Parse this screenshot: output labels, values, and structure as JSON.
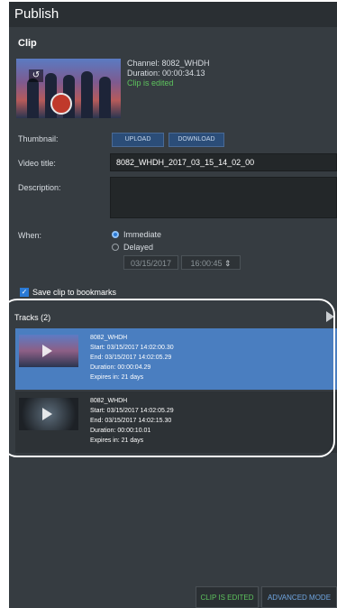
{
  "header": {
    "title": "Publish"
  },
  "clip": {
    "section_title": "Clip",
    "channel": "Channel: 8082_WHDH",
    "duration": "Duration: 00:00:34.13",
    "status": "Clip is edited"
  },
  "form": {
    "thumbnail_label": "Thumbnail:",
    "upload_label": "UPLOAD",
    "download_label": "DOWNLOAD",
    "video_title_label": "Video title:",
    "video_title_value": "8082_WHDH_2017_03_15_14_02_00",
    "description_label": "Description:",
    "description_value": "",
    "when_label": "When:",
    "immediate_label": "Immediate",
    "delayed_label": "Delayed",
    "date_value": "03/15/2017",
    "time_value": "16:00:45",
    "bookmark_label": "Save clip to bookmarks",
    "bookmark_checked": true
  },
  "tracks": {
    "header": "Tracks (2)",
    "items": [
      {
        "name": "8082_WHDH",
        "start": "Start: 03/15/2017 14:02:00.30",
        "end": "End: 03/15/2017 14:02:05.29",
        "duration": "Duration: 00:00:04.29",
        "expires": "Expires in: 21 days",
        "selected": true
      },
      {
        "name": "8082_WHDH",
        "start": "Start: 03/15/2017 14:02:05.29",
        "end": "End: 03/15/2017 14:02:15.30",
        "duration": "Duration: 00:00:10.01",
        "expires": "Expires in: 21 days",
        "selected": false
      }
    ]
  },
  "footer": {
    "clip_edited_label": "CLIP IS EDITED",
    "advanced_label": "ADVANCED MODE"
  },
  "colors": {
    "panel_bg": "#363c41",
    "accent_blue": "#4a7ec0",
    "edited_green": "#5dc25d"
  }
}
